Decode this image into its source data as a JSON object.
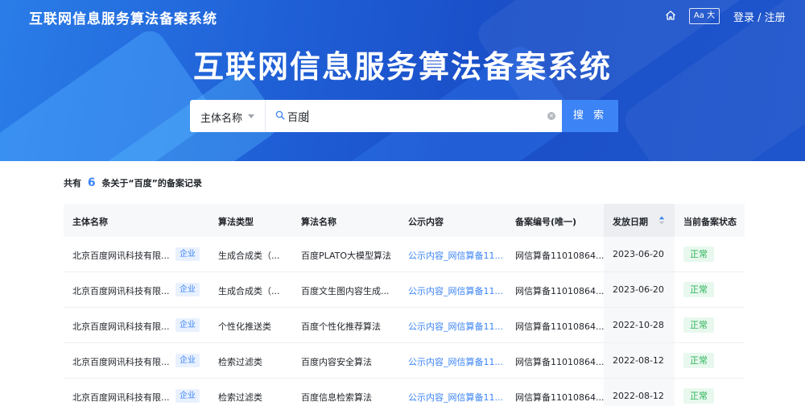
{
  "header": {
    "site_title": "互联网信息服务算法备案系统",
    "font_toggle": "Aa 大",
    "login": "登录 / 注册"
  },
  "hero": {
    "title": "互联网信息服务算法备案系统"
  },
  "search": {
    "select_value": "主体名称",
    "query": "百度",
    "button": "搜 索"
  },
  "summary": {
    "prefix": "共有",
    "count": "6",
    "suffix": "条关于“百度”的备案记录"
  },
  "table": {
    "columns": [
      "主体名称",
      "算法类型",
      "算法名称",
      "公示内容",
      "备案编号(唯一)",
      "发放日期",
      "当前备案状态"
    ],
    "rows": [
      {
        "entity": "北京百度网讯科技有限...",
        "tag": "企业",
        "type": "生成合成类（...",
        "name": "百度PLATO大模型算法",
        "content": "公示内容_网信算备11...",
        "code": "网信算备11010864...",
        "date": "2023-06-20",
        "status": "正常"
      },
      {
        "entity": "北京百度网讯科技有限...",
        "tag": "企业",
        "type": "生成合成类（...",
        "name": "百度文生图内容生成...",
        "content": "公示内容_网信算备11...",
        "code": "网信算备11010864...",
        "date": "2023-06-20",
        "status": "正常"
      },
      {
        "entity": "北京百度网讯科技有限...",
        "tag": "企业",
        "type": "个性化推送类",
        "name": "百度个性化推荐算法",
        "content": "公示内容_网信算备11...",
        "code": "网信算备11010864...",
        "date": "2022-10-28",
        "status": "正常"
      },
      {
        "entity": "北京百度网讯科技有限...",
        "tag": "企业",
        "type": "检索过滤类",
        "name": "百度内容安全算法",
        "content": "公示内容_网信算备11...",
        "code": "网信算备11010864...",
        "date": "2022-08-12",
        "status": "正常"
      },
      {
        "entity": "北京百度网讯科技有限...",
        "tag": "企业",
        "type": "检索过滤类",
        "name": "百度信息检索算法",
        "content": "公示内容_网信算备11...",
        "code": "网信算备11010864...",
        "date": "2022-08-12",
        "status": "正常"
      }
    ]
  },
  "colors": {
    "accent": "#3c84f5",
    "status_ok": "#2fb45a",
    "banner": "#1f5fd6"
  },
  "icons": {
    "home": "home-icon",
    "search": "search-icon",
    "clear": "clear-icon",
    "sort": "sort-icon"
  }
}
